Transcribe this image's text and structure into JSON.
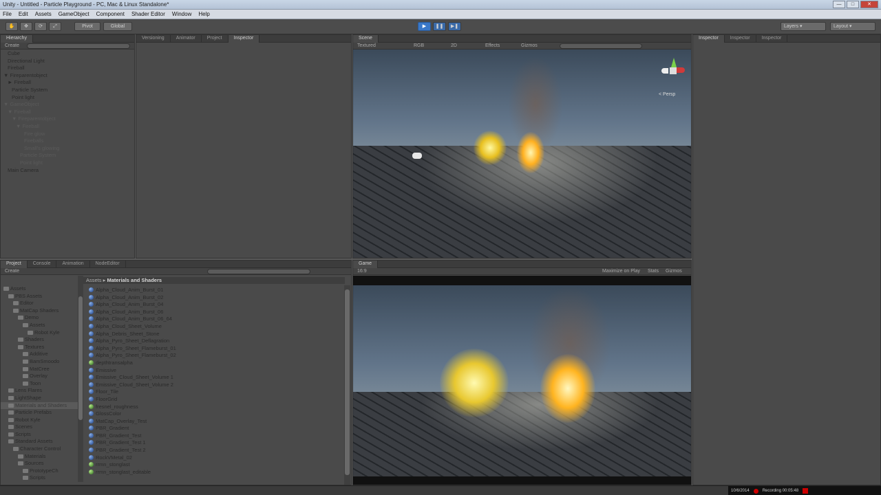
{
  "window": {
    "title": "Unity - Untitled - Particle Playground - PC, Mac & Linux Standalone*"
  },
  "menu": [
    "File",
    "Edit",
    "Assets",
    "GameObject",
    "Component",
    "Shader Editor",
    "Window",
    "Help"
  ],
  "toolbar": {
    "pivot": "Pivot",
    "global": "Global",
    "layers": "Layers",
    "layout": "Layout"
  },
  "hierarchy": {
    "tab": "Hierarchy",
    "create": "Create",
    "items": [
      {
        "label": "Cube",
        "indent": 1,
        "state": "normal"
      },
      {
        "label": "Directional Light",
        "indent": 1,
        "state": "normal"
      },
      {
        "label": "Fireball",
        "indent": 1,
        "state": "normal"
      },
      {
        "label": "▼ Fireparentobject",
        "indent": 0,
        "state": "normal"
      },
      {
        "label": "► Fireball",
        "indent": 1,
        "state": "normal"
      },
      {
        "label": "Particle System",
        "indent": 2,
        "state": "normal"
      },
      {
        "label": "Point light",
        "indent": 2,
        "state": "normal"
      },
      {
        "label": "▼ GameObject",
        "indent": 0,
        "state": "dim"
      },
      {
        "label": "▼ Fireball",
        "indent": 1,
        "state": "dim"
      },
      {
        "label": "▼ Fireparentobject",
        "indent": 2,
        "state": "dim"
      },
      {
        "label": "▼ Fireball",
        "indent": 3,
        "state": "dim"
      },
      {
        "label": "Fire glow",
        "indent": 5,
        "state": "dim"
      },
      {
        "label": "Fireballs",
        "indent": 5,
        "state": "dim"
      },
      {
        "label": "Small's glowing",
        "indent": 5,
        "state": "dim"
      },
      {
        "label": "Particle System",
        "indent": 4,
        "state": "dim"
      },
      {
        "label": "Point light",
        "indent": 4,
        "state": "dim"
      },
      {
        "label": "Main Camera",
        "indent": 1,
        "state": "normal"
      }
    ]
  },
  "middle_tabs": [
    "Versioning",
    "Animator",
    "Project",
    "Inspector"
  ],
  "scene": {
    "tab": "Scene",
    "shading": "Textured",
    "rgb": "RGB",
    "mode2d": "2D",
    "effects": "Effects",
    "gizmos": "Gizmos",
    "persp": "< Persp"
  },
  "game": {
    "tab": "Game",
    "aspect": "16:9",
    "maximize": "Maximize on Play",
    "stats": "Stats",
    "gizmos": "Gizmos"
  },
  "right_tabs": [
    "Inspector",
    "Inspector",
    "Inspector"
  ],
  "project": {
    "tabs": [
      "Project",
      "Console",
      "Animation",
      "NodeEditor"
    ],
    "create": "Create",
    "breadcrumb_root": "Assets",
    "breadcrumb_folder": "Materials and Shaders",
    "folders": [
      {
        "label": "Assets",
        "indent": 0,
        "state": "normal"
      },
      {
        "label": "PBS Assets",
        "indent": 1,
        "state": "normal"
      },
      {
        "label": "Editor",
        "indent": 2,
        "state": "normal"
      },
      {
        "label": "MatCap Shaders",
        "indent": 2,
        "state": "normal"
      },
      {
        "label": "Demo",
        "indent": 3,
        "state": "normal"
      },
      {
        "label": "Assets",
        "indent": 4,
        "state": "normal"
      },
      {
        "label": "Robot Kyle",
        "indent": 5,
        "state": "normal"
      },
      {
        "label": "Shaders",
        "indent": 3,
        "state": "normal"
      },
      {
        "label": "Textures",
        "indent": 3,
        "state": "normal"
      },
      {
        "label": "Additive",
        "indent": 4,
        "state": "normal"
      },
      {
        "label": "BamSmoodo",
        "indent": 4,
        "state": "normal"
      },
      {
        "label": "MatCree",
        "indent": 4,
        "state": "normal"
      },
      {
        "label": "Overlay",
        "indent": 4,
        "state": "normal"
      },
      {
        "label": "Toon",
        "indent": 4,
        "state": "normal"
      },
      {
        "label": "Lens Flares",
        "indent": 1,
        "state": "normal"
      },
      {
        "label": "LightShape",
        "indent": 1,
        "state": "normal"
      },
      {
        "label": "Materials and Shaders",
        "indent": 1,
        "state": "sel"
      },
      {
        "label": "Particle Prefabs",
        "indent": 1,
        "state": "normal"
      },
      {
        "label": "Robot Kyle",
        "indent": 1,
        "state": "normal"
      },
      {
        "label": "Scenes",
        "indent": 1,
        "state": "normal"
      },
      {
        "label": "Scripts",
        "indent": 1,
        "state": "normal"
      },
      {
        "label": "Standard Assets",
        "indent": 1,
        "state": "normal"
      },
      {
        "label": "Character Control",
        "indent": 2,
        "state": "normal"
      },
      {
        "label": "Materials",
        "indent": 3,
        "state": "normal"
      },
      {
        "label": "Sources",
        "indent": 3,
        "state": "normal"
      },
      {
        "label": "PrototypeCh",
        "indent": 4,
        "state": "normal"
      },
      {
        "label": "Scripts",
        "indent": 4,
        "state": "normal"
      }
    ],
    "assets": [
      {
        "label": "Alpha_Cloud_Anim_Burst_01",
        "kind": "sphere"
      },
      {
        "label": "Alpha_Cloud_Anim_Burst_02",
        "kind": "sphere"
      },
      {
        "label": "Alpha_Cloud_Anim_Burst_04",
        "kind": "sphere"
      },
      {
        "label": "Alpha_Cloud_Anim_Burst_06",
        "kind": "sphere"
      },
      {
        "label": "Alpha_Cloud_Anim_Burst_06_64",
        "kind": "sphere"
      },
      {
        "label": "Alpha_Cloud_Sheet_Volume",
        "kind": "sphere"
      },
      {
        "label": "Alpha_Debris_Sheet_Stone",
        "kind": "sphere"
      },
      {
        "label": "Alpha_Pyro_Sheet_Deflagration",
        "kind": "sphere"
      },
      {
        "label": "Alpha_Pyro_Sheet_Flameburst_01",
        "kind": "sphere"
      },
      {
        "label": "Alpha_Pyro_Sheet_Flameburst_02",
        "kind": "sphere"
      },
      {
        "label": "depthtransalpha",
        "kind": "shader"
      },
      {
        "label": "Emissive",
        "kind": "sphere"
      },
      {
        "label": "Emissive_Cloud_Sheet_Volume 1",
        "kind": "sphere"
      },
      {
        "label": "Emissive_Cloud_Sheet_Volume 2",
        "kind": "sphere"
      },
      {
        "label": "Floor_Tile",
        "kind": "sphere"
      },
      {
        "label": "FloorGrid",
        "kind": "sphere"
      },
      {
        "label": "fresnel_roughness",
        "kind": "shader"
      },
      {
        "label": "GlossColor",
        "kind": "sphere"
      },
      {
        "label": "MatCap_Overlay_Test",
        "kind": "sphere"
      },
      {
        "label": "PBR_Gradient",
        "kind": "sphere"
      },
      {
        "label": "PBR_Gradient_Test",
        "kind": "sphere"
      },
      {
        "label": "PBR_Gradient_Test 1",
        "kind": "sphere"
      },
      {
        "label": "PBR_Gradient_Test 2",
        "kind": "sphere"
      },
      {
        "label": "RockVMetal_02",
        "kind": "sphere"
      },
      {
        "label": "rrmn_stonglast",
        "kind": "shader"
      },
      {
        "label": "rrmn_stonglast_editable",
        "kind": "shader"
      }
    ]
  },
  "status": {
    "date": "10/6/2014",
    "recording": "Recording 00:05:48"
  },
  "colors": {
    "accent": "#3a78c8",
    "panel": "#4a4a4a",
    "dark": "#3c3c3c"
  }
}
